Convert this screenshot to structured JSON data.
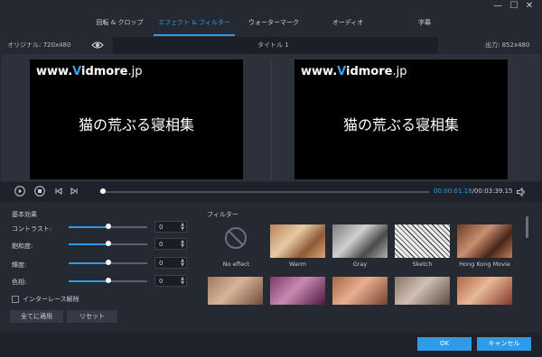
{
  "window": {
    "minimize_glyph": "—",
    "restore_glyph": "☐",
    "close_glyph": "✕"
  },
  "tabs": [
    {
      "label": "回転 & クロップ"
    },
    {
      "label": "エフェクト & フィルター"
    },
    {
      "label": "ウォーターマーク"
    },
    {
      "label": "オーディオ"
    },
    {
      "label": "字幕"
    }
  ],
  "preview": {
    "original_label": "オリジナル: 720x480",
    "title_label": "タイトル 1",
    "output_label": "出力: 852x480",
    "logo_prefix": "www.",
    "logo_v": "V",
    "logo_rest": "idmore",
    "logo_suffix": ".jp",
    "video_text": "猫の荒ぶる寝相集"
  },
  "player": {
    "time_current": "00:00:01.18",
    "time_total": "/00:03:39.15",
    "progress": 0.01
  },
  "basic_effects": {
    "heading": "基本効果",
    "rows": [
      {
        "label": "コントラスト:",
        "value": "0",
        "level": 0.5
      },
      {
        "label": "飽和度:",
        "value": "0",
        "level": 0.5
      },
      {
        "label": "輝度:",
        "value": "0",
        "level": 0.5
      },
      {
        "label": "色相:",
        "value": "0",
        "level": 0.5
      }
    ],
    "deinterlace_label": "インターレース解除",
    "apply_all_label": "全てに適用",
    "reset_label": "リセット"
  },
  "filters": {
    "heading": "フィルター",
    "items": [
      {
        "name": "No effect"
      },
      {
        "name": "Warm"
      },
      {
        "name": "Gray"
      },
      {
        "name": "Sketch"
      },
      {
        "name": "Hong Kong Movie"
      }
    ]
  },
  "footer": {
    "ok_label": "OK",
    "cancel_label": "キャンセル"
  },
  "colors": {
    "accent": "#2f9be8",
    "background": "#252932",
    "video_bg": "#000000"
  }
}
